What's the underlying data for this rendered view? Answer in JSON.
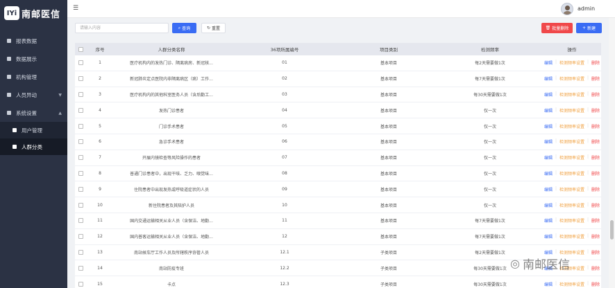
{
  "brand": {
    "logo_mark": "IYi",
    "logo_text": "南邮医信"
  },
  "sidebar": {
    "items": [
      {
        "label": "报表数据",
        "icon": "report-icon"
      },
      {
        "label": "数据展示",
        "icon": "data-display-icon"
      },
      {
        "label": "机构管理",
        "icon": "org-icon"
      },
      {
        "label": "人员异动",
        "icon": "person-change-icon"
      },
      {
        "label": "系统设置",
        "icon": "settings-icon"
      }
    ],
    "submenu": [
      {
        "label": "用户管理",
        "icon": "user-icon"
      },
      {
        "label": "人群分类",
        "icon": "group-icon",
        "active": true
      }
    ]
  },
  "header": {
    "user": "admin"
  },
  "toolbar": {
    "search_placeholder": "请输入内容",
    "query_label": "查询",
    "reset_label": "重置",
    "batch_delete_label": "批量删除",
    "add_label": "新建"
  },
  "table": {
    "columns": [
      "序号",
      "人群分类名称",
      "36项所属编号",
      "项目类别",
      "检测频率",
      "操作"
    ],
    "ops": {
      "edit": "编辑",
      "set": "检测频率设置",
      "delete": "删除"
    },
    "rows": [
      {
        "idx": "1",
        "name": "医疗机构内的发热门诊、隔离病房、新冠核...",
        "code": "01",
        "type": "基本项目",
        "freq": "每2天需要做1次"
      },
      {
        "idx": "2",
        "name": "新冠肺炎定点医院内非隔离病区（病）工作...",
        "code": "02",
        "type": "基本项目",
        "freq": "每7天需要做1次"
      },
      {
        "idx": "3",
        "name": "医疗机构内的其他科室医务人员（含后勤工...",
        "code": "03",
        "type": "基本项目",
        "freq": "每30天需要做1次"
      },
      {
        "idx": "4",
        "name": "发热门诊患者",
        "code": "04",
        "type": "基本项目",
        "freq": "仅一次"
      },
      {
        "idx": "5",
        "name": "门诊手术患者",
        "code": "05",
        "type": "基本项目",
        "freq": "仅一次"
      },
      {
        "idx": "6",
        "name": "急诊手术患者",
        "code": "06",
        "type": "基本项目",
        "freq": "仅一次"
      },
      {
        "idx": "7",
        "name": "开展内镜检查等风险操作的患者",
        "code": "07",
        "type": "基本项目",
        "freq": "仅一次"
      },
      {
        "idx": "8",
        "name": "普通门诊患者中，出现干咳、乏力、嗅觉味...",
        "code": "08",
        "type": "基本项目",
        "freq": "仅一次"
      },
      {
        "idx": "9",
        "name": "住院患者中出现发热或呼吸道症状的人员",
        "code": "09",
        "type": "基本项目",
        "freq": "仅一次"
      },
      {
        "idx": "10",
        "name": "新住院患者及其陪护人员",
        "code": "10",
        "type": "基本项目",
        "freq": "仅一次"
      },
      {
        "idx": "11",
        "name": "国内交通运输相关从业人员（含保洁、地勤...",
        "code": "11",
        "type": "基本项目",
        "freq": "每7天需要做1次"
      },
      {
        "idx": "12",
        "name": "国内普客运输相关从业人员（含保洁、地勤...",
        "code": "12",
        "type": "基本项目",
        "freq": "每7天需要做1次"
      },
      {
        "idx": "13",
        "name": "南站候车厅工作人员及所辖秩序协管人员",
        "code": "12.1",
        "type": "子类项目",
        "freq": "每2天需要做1次"
      },
      {
        "idx": "14",
        "name": "南站防疫专班",
        "code": "12.2",
        "type": "子类项目",
        "freq": "每30天需要做1次"
      },
      {
        "idx": "15",
        "name": "卡点",
        "code": "12.3",
        "type": "子类项目",
        "freq": "每30天需要做1次"
      }
    ]
  },
  "watermark": {
    "text": "南邮医信"
  }
}
